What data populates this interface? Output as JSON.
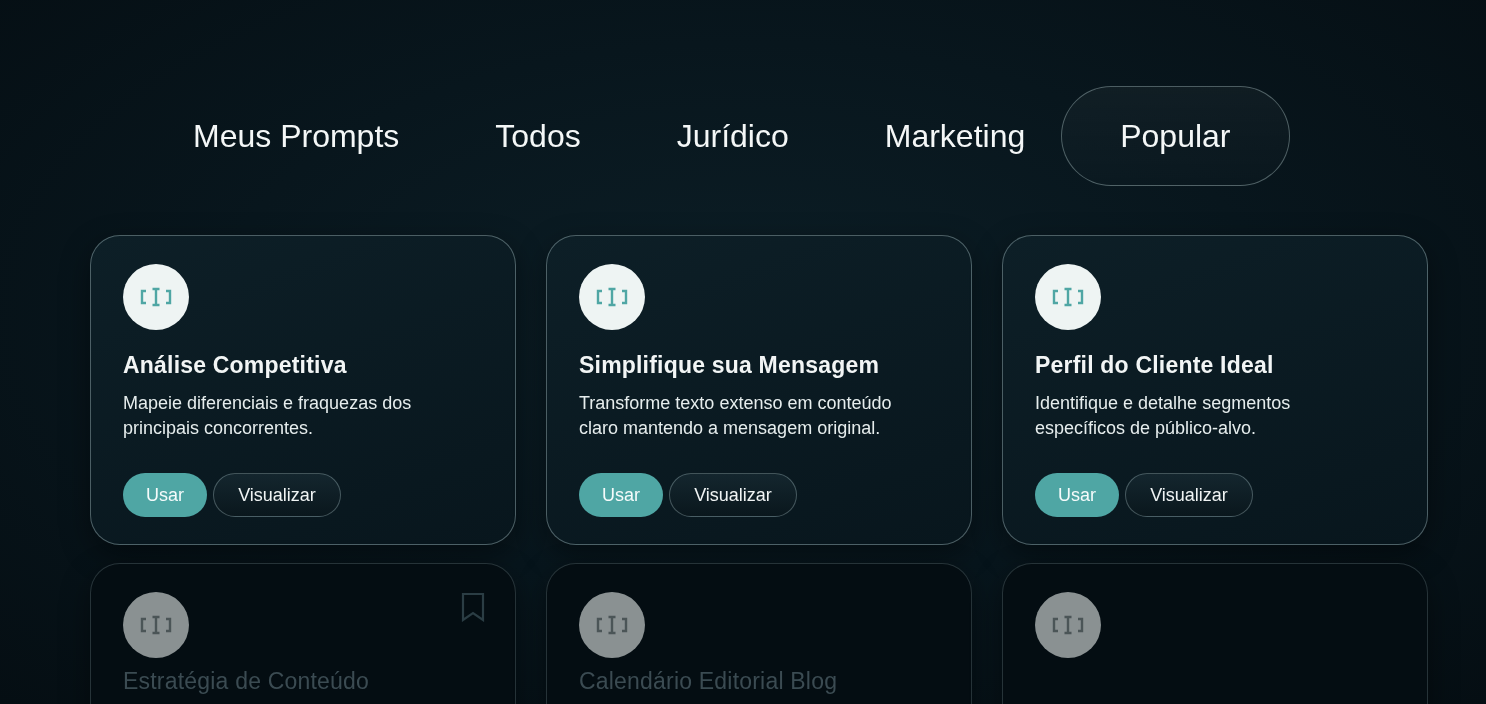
{
  "tabs": [
    {
      "label": "Meus Prompts",
      "selected": false
    },
    {
      "label": "Todos",
      "selected": false
    },
    {
      "label": "Jurídico",
      "selected": false
    },
    {
      "label": "Marketing",
      "selected": false
    },
    {
      "label": "Popular",
      "selected": true
    }
  ],
  "cards": [
    {
      "title": "Análise Competitiva",
      "description": "Mapeie diferenciais e fraquezas dos principais concorrentes.",
      "dimmed": false,
      "bookmark": false,
      "buttons": [
        "Usar",
        "Visualizar"
      ]
    },
    {
      "title": "Simplifique sua Mensagem",
      "description": "Transforme texto extenso em conteúdo claro mantendo a mensagem original.",
      "dimmed": false,
      "bookmark": false,
      "buttons": [
        "Usar",
        "Visualizar"
      ]
    },
    {
      "title": "Perfil do Cliente Ideal",
      "description": "Identifique e detalhe segmentos específicos de público-alvo.",
      "dimmed": false,
      "bookmark": false,
      "buttons": [
        "Usar",
        "Visualizar"
      ]
    },
    {
      "title": "Estratégia de Conteúdo",
      "dimmed": true,
      "bookmark": true
    },
    {
      "title": "Calendário Editorial Blog",
      "dimmed": true,
      "bookmark": false
    },
    {
      "dimmed": true,
      "bookmark": false
    }
  ]
}
